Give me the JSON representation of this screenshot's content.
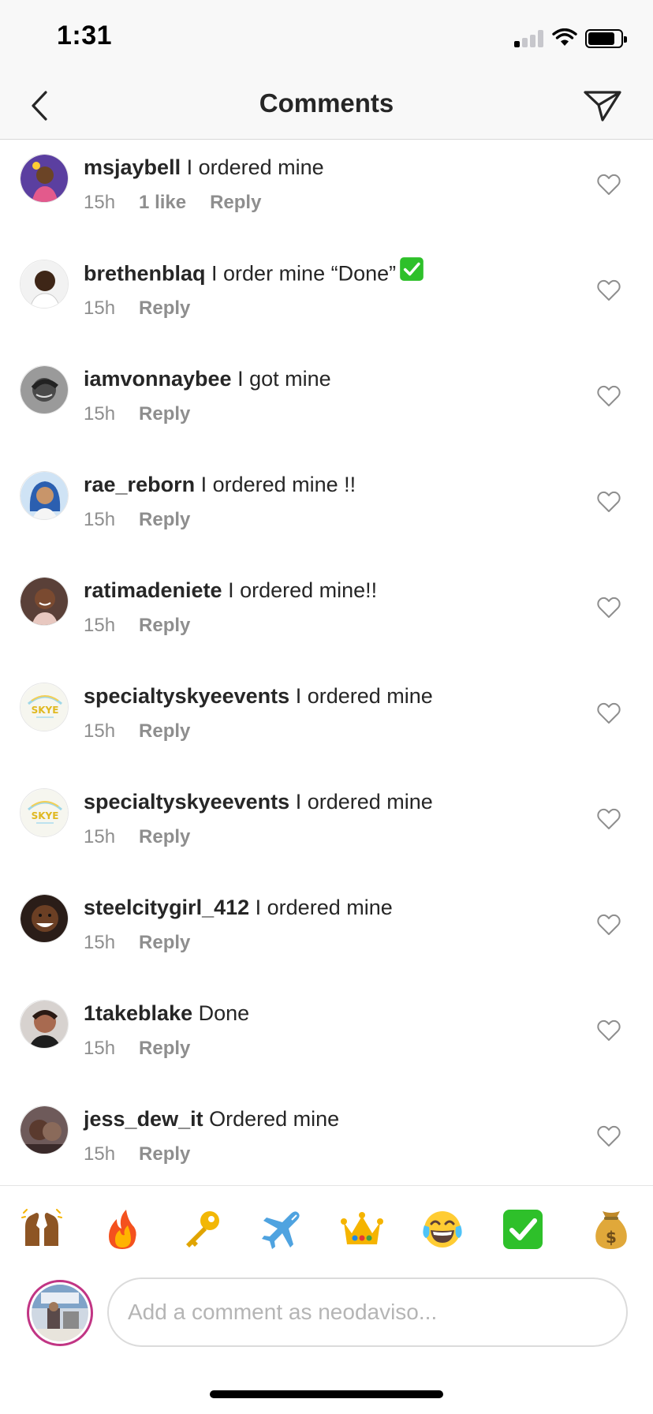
{
  "status_bar": {
    "time": "1:31",
    "signal_bars": 4,
    "signal_active": 1
  },
  "header": {
    "title": "Comments",
    "back_icon": "chevron-left-icon",
    "action_icon": "paper-plane-icon"
  },
  "comments": [
    {
      "username": "msjaybell",
      "text": "I ordered mine",
      "time": "15h",
      "likes": "1 like",
      "reply": "Reply",
      "has_check": false,
      "avatar_color": "#5b3fa0"
    },
    {
      "username": "brethenblaq",
      "text": "I order mine “Done”",
      "time": "15h",
      "likes": "",
      "reply": "Reply",
      "has_check": true,
      "avatar_color": "#f2f2f2"
    },
    {
      "username": "iamvonnaybee",
      "text": "I got mine",
      "time": "15h",
      "likes": "",
      "reply": "Reply",
      "has_check": false,
      "avatar_color": "#8a8a8a"
    },
    {
      "username": "rae_reborn",
      "text": "I ordered mine !!",
      "time": "15h",
      "likes": "",
      "reply": "Reply",
      "has_check": false,
      "avatar_color": "#3f6fb5"
    },
    {
      "username": "ratimadeniete",
      "text": "I ordered mine!!",
      "time": "15h",
      "likes": "",
      "reply": "Reply",
      "has_check": false,
      "avatar_color": "#7a4a35"
    },
    {
      "username": "specialtyskyeevents",
      "text": "I ordered mine",
      "time": "15h",
      "likes": "",
      "reply": "Reply",
      "has_check": false,
      "avatar_color": "#f4f4ee"
    },
    {
      "username": "specialtyskyeevents",
      "text": "I ordered mine",
      "time": "15h",
      "likes": "",
      "reply": "Reply",
      "has_check": false,
      "avatar_color": "#f4f4ee"
    },
    {
      "username": "steelcitygirl_412",
      "text": "I ordered mine",
      "time": "15h",
      "likes": "",
      "reply": "Reply",
      "has_check": false,
      "avatar_color": "#3b2a22"
    },
    {
      "username": "1takeblake",
      "text": "Done",
      "time": "15h",
      "likes": "",
      "reply": "Reply",
      "has_check": false,
      "avatar_color": "#6b4b3e"
    },
    {
      "username": "jess_dew_it",
      "text": "Ordered mine",
      "time": "15h",
      "likes": "",
      "reply": "Reply",
      "has_check": false,
      "avatar_color": "#4a3a3a"
    }
  ],
  "quick_emojis": [
    "raised-hands",
    "fire",
    "key",
    "airplane",
    "crown",
    "tears-of-joy",
    "check-mark-button",
    "money-bag"
  ],
  "composer": {
    "placeholder": "Add a comment as neodaviso..."
  },
  "colors": {
    "meta_gray": "#8e8e8e",
    "text": "#262626",
    "check_green": "#2ec02a",
    "story_ring": "#c13584"
  }
}
